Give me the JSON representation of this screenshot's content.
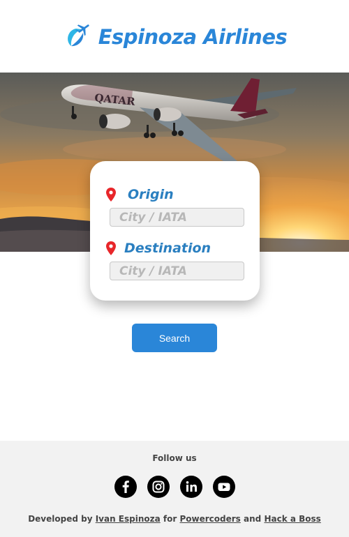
{
  "header": {
    "title": "Espinoza Airlines",
    "logo_icon": "plane-logo-icon"
  },
  "hero": {
    "image": "airplane-takeoff-sunset",
    "plane_livery_text": "QATAR"
  },
  "search_form": {
    "origin": {
      "label": "Origin",
      "placeholder": "City / IATA",
      "value": ""
    },
    "destination": {
      "label": "Destination",
      "placeholder": "City / IATA",
      "value": ""
    },
    "pin_icon_color": "#e8262a",
    "label_color": "#2a7fc0"
  },
  "search_button": {
    "label": "Search",
    "color": "#2a86d8"
  },
  "footer": {
    "follow_label": "Follow us",
    "social_icons": [
      "facebook-icon",
      "instagram-icon",
      "linkedin-icon",
      "youtube-icon"
    ],
    "credits": {
      "prefix": "Developed by",
      "author": "Ivan Espinoza",
      "for_text": "for",
      "org1": "Powercoders",
      "and_text": "and",
      "org2": "Hack a Boss"
    }
  }
}
